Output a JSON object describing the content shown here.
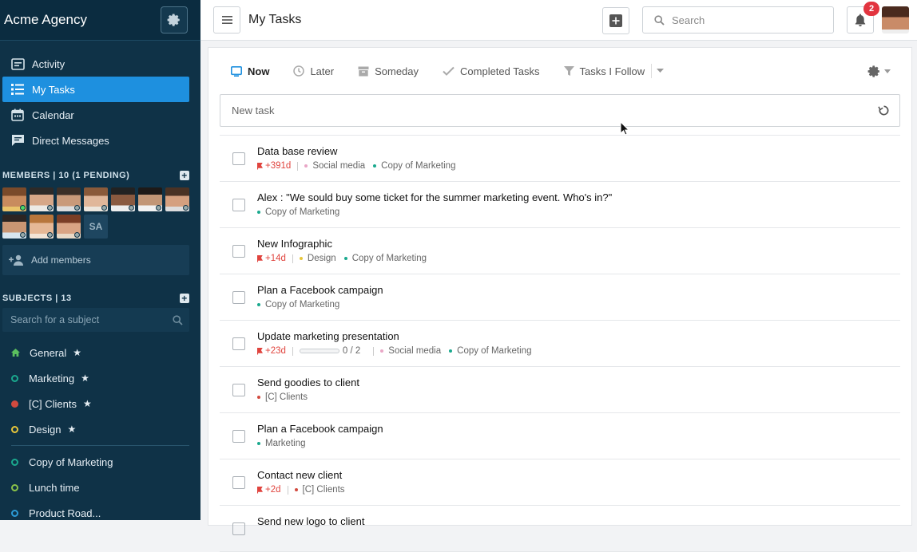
{
  "app": {
    "name": "Acme Agency"
  },
  "sidebar": {
    "nav": [
      {
        "label": "Activity",
        "icon": "activity-icon"
      },
      {
        "label": "My Tasks",
        "icon": "tasks-icon",
        "active": true
      },
      {
        "label": "Calendar",
        "icon": "calendar-icon"
      },
      {
        "label": "Direct Messages",
        "icon": "chat-icon"
      }
    ],
    "members_heading": "MEMBERS | 10 (1 PENDING)",
    "pending_member_initials": "SA",
    "add_members_label": "Add members",
    "subjects_heading": "SUBJECTS | 13",
    "subject_search_placeholder": "Search for a subject",
    "subjects": [
      {
        "label": "General",
        "color": "#5bbf5e",
        "starred": true,
        "star": "★",
        "icon": "home-icon"
      },
      {
        "label": "Marketing",
        "color": "#1aa98e",
        "starred": true,
        "star": "★"
      },
      {
        "label": "[C] Clients",
        "color": "#d24a3f",
        "starred": true,
        "star": "★"
      },
      {
        "label": "Design",
        "color": "#e7c63a",
        "starred": true,
        "star": "★"
      }
    ],
    "subjects_more": [
      {
        "label": "Copy of Marketing",
        "color": "#1aa98e"
      },
      {
        "label": "Lunch time",
        "color": "#8bc34a"
      },
      {
        "label": "Product Road...",
        "color": "#2c9bd6"
      }
    ]
  },
  "topbar": {
    "title": "My Tasks",
    "search_placeholder": "Search",
    "notification_count": "2"
  },
  "tabs": [
    {
      "label": "Now",
      "icon": "inbox-icon",
      "active": true
    },
    {
      "label": "Later",
      "icon": "clock-icon"
    },
    {
      "label": "Someday",
      "icon": "archive-icon"
    },
    {
      "label": "Completed Tasks",
      "icon": "check-icon"
    },
    {
      "label": "Tasks I Follow",
      "icon": "filter-icon"
    }
  ],
  "new_task_placeholder": "New task",
  "colors": {
    "accent": "#1e90df",
    "overdue": "#e0443e",
    "sidebar": "#0f3247"
  },
  "tasks": [
    {
      "title": "Data base review",
      "due": "+391d",
      "tags": [
        {
          "label": "Social media",
          "color": "#e9a6c6"
        },
        {
          "label": "Copy of Marketing",
          "color": "#1aa98e"
        }
      ]
    },
    {
      "title": "Alex : \"We sould buy some ticket for the summer marketing event. Who's in?\"",
      "due": "",
      "tags": [
        {
          "label": "Copy of Marketing",
          "color": "#1aa98e"
        }
      ]
    },
    {
      "title": "New Infographic",
      "due": "+14d",
      "tags": [
        {
          "label": "Design",
          "color": "#e7c63a"
        },
        {
          "label": "Copy of Marketing",
          "color": "#1aa98e"
        }
      ]
    },
    {
      "title": "Plan a Facebook campaign",
      "due": "",
      "tags": [
        {
          "label": "Copy of Marketing",
          "color": "#1aa98e"
        }
      ]
    },
    {
      "title": "Update marketing presentation",
      "due": "+23d",
      "progress": "0 / 2",
      "progress_fraction": 0,
      "tags": [
        {
          "label": "Social media",
          "color": "#e9a6c6"
        },
        {
          "label": "Copy of Marketing",
          "color": "#1aa98e"
        }
      ]
    },
    {
      "title": "Send goodies to client",
      "due": "",
      "tags": [
        {
          "label": "[C] Clients",
          "color": "#d24a3f"
        }
      ]
    },
    {
      "title": "Plan a Facebook campaign",
      "due": "",
      "tags": [
        {
          "label": "Marketing",
          "color": "#1aa98e"
        }
      ]
    },
    {
      "title": "Contact new client",
      "due": "+2d",
      "tags": [
        {
          "label": "[C] Clients",
          "color": "#d24a3f"
        }
      ]
    },
    {
      "title": "Send new logo to client",
      "due": "",
      "tags": []
    }
  ]
}
